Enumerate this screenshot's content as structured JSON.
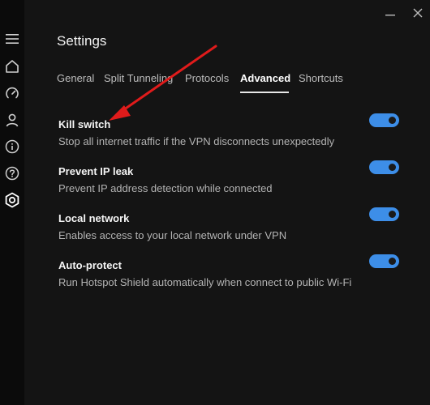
{
  "window": {
    "minimize_icon": "minimize-icon",
    "close_icon": "close-icon"
  },
  "sidebar": {
    "items": [
      {
        "icon": "hamburger-menu-icon"
      },
      {
        "icon": "home-icon"
      },
      {
        "icon": "speedometer-icon"
      },
      {
        "icon": "user-icon"
      },
      {
        "icon": "info-icon"
      },
      {
        "icon": "help-icon"
      },
      {
        "icon": "settings-gear-icon",
        "active": true
      }
    ]
  },
  "page": {
    "title": "Settings"
  },
  "tabs": [
    {
      "label": "General"
    },
    {
      "label": "Split Tunneling"
    },
    {
      "label": "Protocols"
    },
    {
      "label": "Advanced",
      "active": true
    },
    {
      "label": "Shortcuts"
    }
  ],
  "settings": [
    {
      "title": "Kill switch",
      "description": "Stop all internet traffic if the VPN disconnects unexpectedly",
      "enabled": true
    },
    {
      "title": "Prevent IP leak",
      "description": "Prevent IP address detection while connected",
      "enabled": true
    },
    {
      "title": "Local network",
      "description": "Enables access to your local network under VPN",
      "enabled": true
    },
    {
      "title": "Auto-protect",
      "description": "Run Hotspot Shield automatically when connect to public Wi-Fi",
      "enabled": true
    }
  ],
  "colors": {
    "background": "#141414",
    "sidebar": "#0b0b0b",
    "toggle_on": "#3d8ee8",
    "annotation_arrow": "#e01b1b"
  }
}
